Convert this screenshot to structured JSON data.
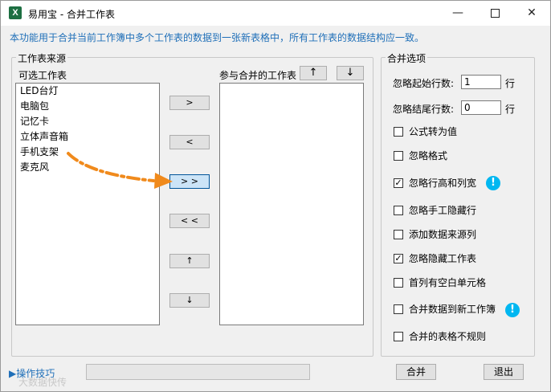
{
  "window": {
    "icon_letter": "X",
    "title": "易用宝 - 合并工作表",
    "minimize": "—",
    "close": "✕"
  },
  "description": "本功能用于合并当前工作簿中多个工作表的数据到一张新表格中，所有工作表的数据结构应一致。",
  "source_group": {
    "label": "工作表来源",
    "available_label": "可选工作表",
    "merge_label": "参与合并的工作表",
    "available_items": [
      "LED台灯",
      "电脑包",
      "记忆卡",
      "立体声音箱",
      "手机支架",
      "麦克风"
    ],
    "merge_items": [],
    "move_up": "↑",
    "move_down": "↓",
    "add_one": ">",
    "remove_one": "<",
    "add_all": "> >",
    "remove_all": "< <",
    "order_up": "↑",
    "order_down": "↓"
  },
  "options_group": {
    "label": "合并选项",
    "skip_start_rows_label": "忽略起始行数:",
    "skip_start_rows_value": "1",
    "skip_end_rows_label": "忽略结尾行数:",
    "skip_end_rows_value": "0",
    "unit": "行",
    "checkboxes": [
      {
        "label": "公式转为值",
        "checked": false,
        "mark": ""
      },
      {
        "label": "忽略格式",
        "checked": false,
        "mark": ""
      },
      {
        "label": "忽略行高和列宽",
        "checked": true,
        "mark": "✓"
      },
      {
        "label": "忽略手工隐藏行",
        "checked": false,
        "mark": ""
      },
      {
        "label": "添加数据来源列",
        "checked": false,
        "mark": ""
      },
      {
        "label": "忽略隐藏工作表",
        "checked": true,
        "mark": "✓"
      },
      {
        "label": "首列有空白单元格",
        "checked": false,
        "mark": ""
      },
      {
        "label": "合并数据到新工作簿",
        "checked": false,
        "mark": ""
      },
      {
        "label": "合并的表格不规则",
        "checked": false,
        "mark": ""
      }
    ],
    "info_mark": "!"
  },
  "footer": {
    "tips_link": "▶操作技巧",
    "merge_button": "合并",
    "exit_button": "退出",
    "watermark": "大数据快传"
  },
  "colors": {
    "accent": "#1f6fb8",
    "info": "#00b7f1",
    "arrow": "#f08a1c"
  }
}
